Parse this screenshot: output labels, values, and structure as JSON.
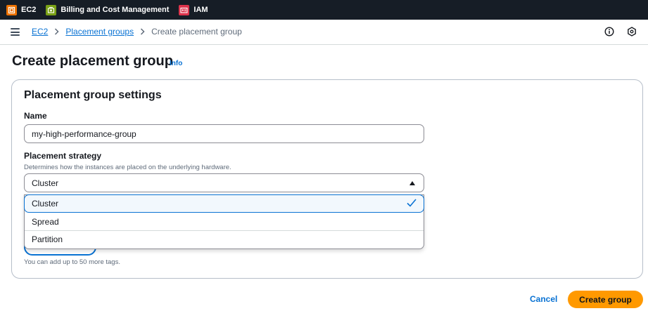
{
  "topbar": {
    "favorites": [
      {
        "label": "EC2",
        "icon": "ec2-icon",
        "color": "#ed7100"
      },
      {
        "label": "Billing and Cost Management",
        "icon": "billing-icon",
        "color": "#7aa116"
      },
      {
        "label": "IAM",
        "icon": "iam-icon",
        "color": "#dd344c"
      }
    ]
  },
  "breadcrumb": {
    "items": [
      "EC2",
      "Placement groups"
    ],
    "current": "Create placement group"
  },
  "header": {
    "title": "Create placement group",
    "info": "Info"
  },
  "panel": {
    "title": "Placement group settings",
    "name_label": "Name",
    "name_value": "my-high-performance-group",
    "strategy_label": "Placement strategy",
    "strategy_desc": "Determines how the instances are placed on the underlying hardware.",
    "strategy_value": "Cluster",
    "options": [
      "Cluster",
      "Spread",
      "Partition"
    ],
    "tag_hint": "You can add up to 50 more tags."
  },
  "actions": {
    "cancel": "Cancel",
    "create": "Create group"
  },
  "colors": {
    "accent": "#0972d3",
    "primary_button": "#ff9900",
    "topbar": "#161d26"
  }
}
